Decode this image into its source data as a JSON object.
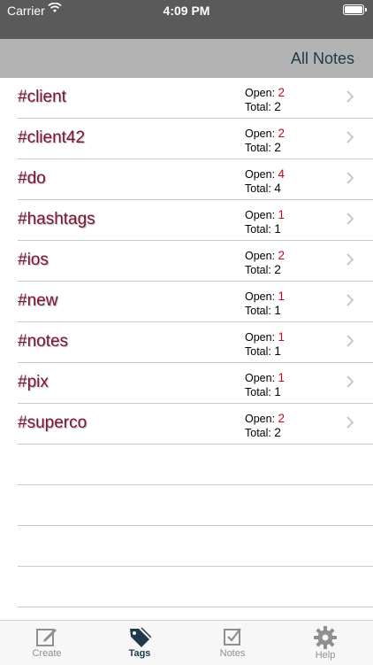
{
  "status_bar": {
    "carrier": "Carrier",
    "time": "4:09 PM"
  },
  "nav_bar": {
    "title": "All Notes"
  },
  "tags": [
    {
      "name": "#client",
      "open_label": "Open:",
      "open": "2",
      "total_label": "Total:",
      "total": "2"
    },
    {
      "name": "#client42",
      "open_label": "Open:",
      "open": "2",
      "total_label": "Total:",
      "total": "2"
    },
    {
      "name": "#do",
      "open_label": "Open:",
      "open": "4",
      "total_label": "Total:",
      "total": "4"
    },
    {
      "name": "#hashtags",
      "open_label": "Open:",
      "open": "1",
      "total_label": "Total:",
      "total": "1"
    },
    {
      "name": "#ios",
      "open_label": "Open:",
      "open": "2",
      "total_label": "Total:",
      "total": "2"
    },
    {
      "name": "#new",
      "open_label": "Open:",
      "open": "1",
      "total_label": "Total:",
      "total": "1"
    },
    {
      "name": "#notes",
      "open_label": "Open:",
      "open": "1",
      "total_label": "Total:",
      "total": "1"
    },
    {
      "name": "#pix",
      "open_label": "Open:",
      "open": "1",
      "total_label": "Total:",
      "total": "1"
    },
    {
      "name": "#superco",
      "open_label": "Open:",
      "open": "2",
      "total_label": "Total:",
      "total": "2"
    }
  ],
  "tab_bar": {
    "tabs": [
      {
        "label": "Create",
        "icon": "compose-icon"
      },
      {
        "label": "Tags",
        "icon": "tag-icon",
        "active": true
      },
      {
        "label": "Notes",
        "icon": "checkbox-icon"
      },
      {
        "label": "Help",
        "icon": "gear-icon"
      }
    ]
  },
  "colors": {
    "tag_text": "#7a1430",
    "open_count": "#d0021b",
    "active_tab": "#1e3a4a",
    "inactive_tab": "#8e8e93",
    "nav_bar": "#b3b3b3",
    "status_bar": "#5a5a5a"
  }
}
